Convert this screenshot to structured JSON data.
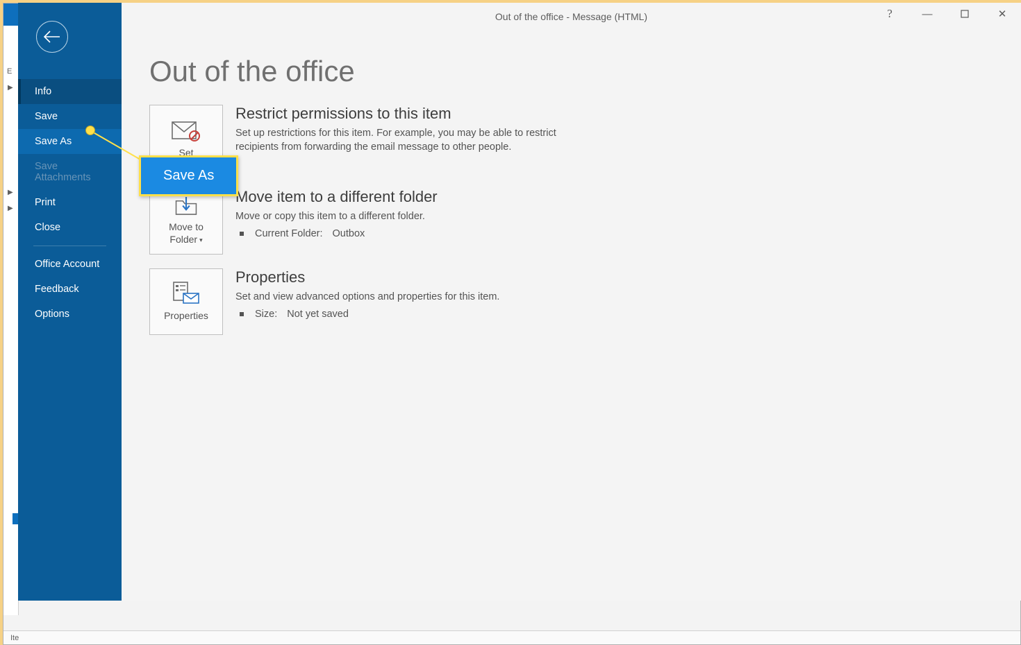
{
  "title_bar": "Out of the office  -  Message (HTML)",
  "window_controls": {
    "help": "?",
    "minimize": "—",
    "maximize": "▢",
    "close": "✕"
  },
  "sidebar": {
    "items": [
      {
        "label": "Info",
        "state": "selected"
      },
      {
        "label": "Save",
        "state": ""
      },
      {
        "label": "Save As",
        "state": "hover-alt"
      },
      {
        "label": "Save Attachments",
        "state": "disabled"
      },
      {
        "label": "Print",
        "state": ""
      },
      {
        "label": "Close",
        "state": ""
      }
    ],
    "items2": [
      {
        "label": "Office Account"
      },
      {
        "label": "Feedback"
      },
      {
        "label": "Options"
      }
    ]
  },
  "page_title": "Out of the office",
  "sections": {
    "restrict": {
      "button": "Set",
      "heading": "Restrict permissions to this item",
      "body": "Set up restrictions for this item. For example, you may be able to restrict recipients from forwarding the email message to other people."
    },
    "move": {
      "button": "Move to Folder",
      "heading": "Move item to a different folder",
      "body": "Move or copy this item to a different folder.",
      "kv_label": "Current Folder:",
      "kv_value": "Outbox"
    },
    "properties": {
      "button": "Properties",
      "heading": "Properties",
      "body": "Set and view advanced options and properties for this item.",
      "kv_label": "Size:",
      "kv_value": "Not yet saved"
    }
  },
  "callout": "Save As",
  "backdrop": {
    "status": "Ite",
    "left": "E"
  }
}
